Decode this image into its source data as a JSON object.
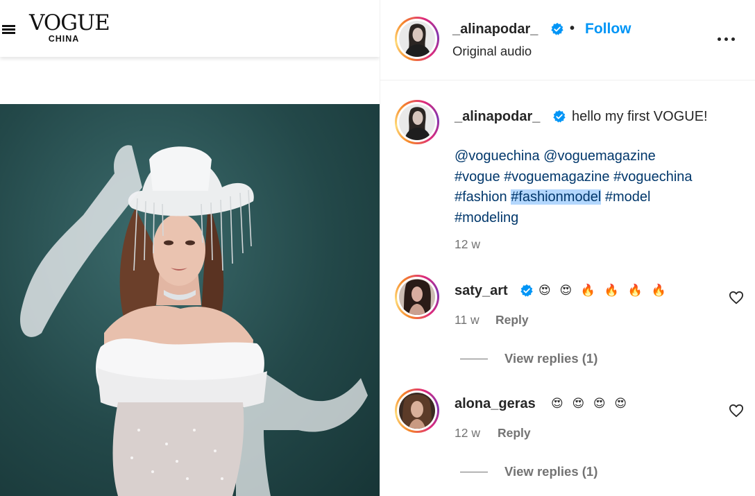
{
  "vogue": {
    "logo_word": "VOGUE",
    "logo_sub": "CHINA"
  },
  "post": {
    "username": "_alinapodar_",
    "separator": "•",
    "follow_label": "Follow",
    "audio_label": "Original audio",
    "caption": "hello my first VOGUE!",
    "tags": [
      "@voguechina",
      "@voguemagazine",
      "#vogue",
      "#voguemagazine",
      "#voguechina",
      "#fashion",
      "#fashionmodel",
      "#model",
      "#modeling"
    ],
    "time": "12 w"
  },
  "comments": [
    {
      "username": "saty_art",
      "verified": true,
      "text": "😍 😍 🔥 🔥 🔥 🔥",
      "time": "11 w",
      "reply_label": "Reply",
      "view_replies": "View replies (1)"
    },
    {
      "username": "alona_geras",
      "verified": false,
      "text": "😍 😍 😍 😍",
      "time": "12 w",
      "reply_label": "Reply",
      "view_replies": "View replies (1)"
    }
  ],
  "colors": {
    "accent": "#0095f6",
    "hashtag": "#00376b",
    "secondary_text": "#737373",
    "highlight": "#b3d7fd"
  }
}
